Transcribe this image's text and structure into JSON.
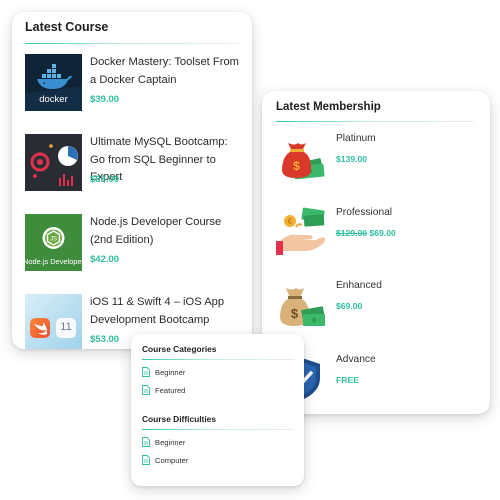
{
  "latest_course": {
    "title": "Latest Course",
    "courses": [
      {
        "name": "Docker Mastery: Toolset From a Docker Captain",
        "price": "$39.00",
        "thumb_label": "docker"
      },
      {
        "name": "Ultimate MySQL Bootcamp: Go from SQL Beginner to Expert",
        "price": "$65.00"
      },
      {
        "name": "Node.js Developer Course (2nd Edition)",
        "price": "$42.00",
        "thumb_label": "Node.js Developer"
      },
      {
        "name": "iOS 11 & Swift 4 – iOS App Development Bootcamp",
        "price": "$53.00",
        "thumb_label": "11"
      }
    ]
  },
  "latest_membership": {
    "title": "Latest Membership",
    "plans": [
      {
        "name": "Platinum",
        "price": "$139.00",
        "icon": "money-bag-cash-icon"
      },
      {
        "name": "Professional",
        "old_price": "$129.00",
        "price": "$69.00",
        "icon": "hand-dollar-coins-icon"
      },
      {
        "name": "Enhanced",
        "price": "$69.00",
        "icon": "dollar-sack-cash-icon"
      },
      {
        "name": "Advance",
        "price": "FREE",
        "icon": "shield-check-icon"
      }
    ]
  },
  "course_categories": {
    "title": "Course Categories",
    "items": [
      "Beginner",
      "Featured"
    ]
  },
  "course_difficulties": {
    "title": "Course Difficulties",
    "items": [
      "Beginner",
      "Computer"
    ]
  },
  "colors": {
    "accent": "#2fbf9f",
    "rule_start": "#2fc9a7",
    "text": "#2b2b2b",
    "docker_thumb_bg": "#0e2233",
    "mysql_thumb_bg": "#2a2c33",
    "node_thumb_bg": "#3f8c3d",
    "ios_thumb_bg": "#bfe4f2"
  }
}
